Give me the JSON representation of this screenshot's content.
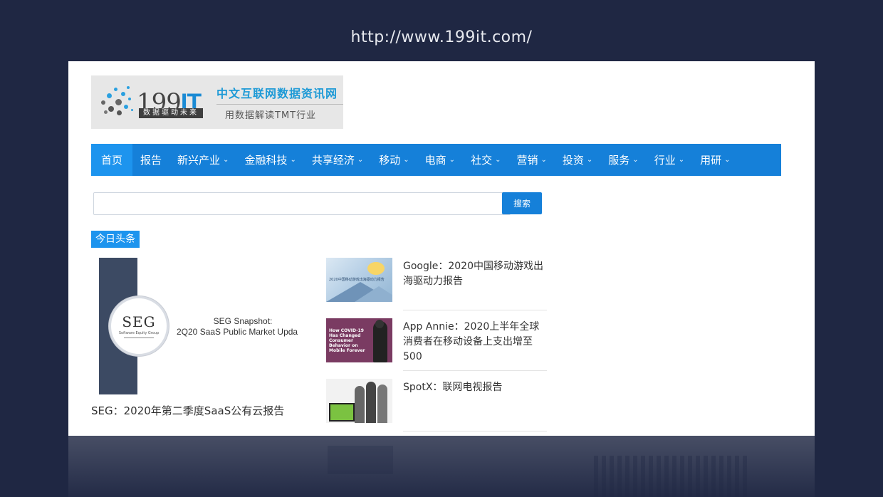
{
  "url": "http://www.199it.com/",
  "logo": {
    "name_num": "199",
    "name_it": "IT",
    "tagline": "数据驱动未来",
    "cn_title": "中文互联网数据资讯网",
    "cn_sub": "用数据解读TMT行业"
  },
  "nav": {
    "items": [
      {
        "label": "首页",
        "dropdown": false
      },
      {
        "label": "报告",
        "dropdown": false
      },
      {
        "label": "新兴产业",
        "dropdown": true
      },
      {
        "label": "金融科技",
        "dropdown": true
      },
      {
        "label": "共享经济",
        "dropdown": true
      },
      {
        "label": "移动",
        "dropdown": true
      },
      {
        "label": "电商",
        "dropdown": true
      },
      {
        "label": "社交",
        "dropdown": true
      },
      {
        "label": "营销",
        "dropdown": true
      },
      {
        "label": "投资",
        "dropdown": true
      },
      {
        "label": "服务",
        "dropdown": true
      },
      {
        "label": "行业",
        "dropdown": true
      },
      {
        "label": "用研",
        "dropdown": true
      }
    ],
    "active_index": 0,
    "chevron": "⌄"
  },
  "search": {
    "value": "",
    "placeholder": "",
    "button_label": "搜索"
  },
  "section": {
    "label": "今日头条"
  },
  "featured": {
    "image_logo": "SEG",
    "image_logo_sub": "Software Equity Group",
    "image_title": "SEG Snapshot:",
    "image_subtitle": "2Q20 SaaS Public Market Upda",
    "caption": "SEG：2020年第二季度SaaS公有云报告"
  },
  "articles": [
    {
      "title": "Google：2020中国移动游戏出海驱动力报告",
      "thumb_text": "2020中国移动游戏出海驱动力报告"
    },
    {
      "title": "App Annie：2020上半年全球消费者在移动设备上支出增至500",
      "thumb_text": "How COVID-19 Has Changed Consumer Behavior on Mobile Forever"
    },
    {
      "title": "SpotX：联网电视报告",
      "thumb_text": ""
    }
  ],
  "colors": {
    "background": "#1f2743",
    "nav": "#1580d9",
    "nav_active": "#1d94ee",
    "accent": "#1e9ad6"
  }
}
